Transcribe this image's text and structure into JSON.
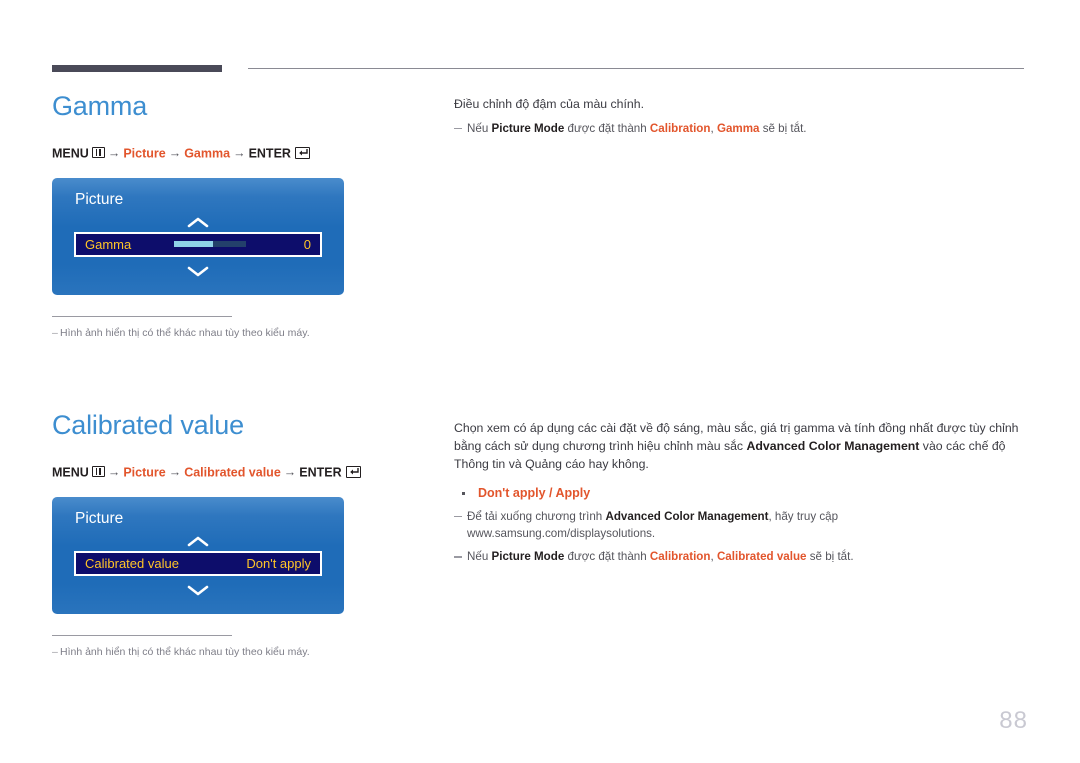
{
  "page": {
    "number": "88"
  },
  "sections": [
    {
      "title": "Gamma",
      "menu_path": {
        "menu_label": "MENU",
        "menu_icon": "menu-grid-icon",
        "arrow": "→",
        "step1": "Picture",
        "step2": "Gamma",
        "enter_label": "ENTER",
        "enter_icon": "enter-return-icon"
      },
      "osd": {
        "title": "Picture",
        "up_icon": "chevron-up-icon",
        "down_icon": "chevron-down-icon",
        "row_label": "Gamma",
        "row_value": "0",
        "slider_percent": 55,
        "has_slider": true
      },
      "footnote": "Hình ảnh hiển thị có thể khác nhau tùy theo kiểu máy.",
      "right": {
        "intro": "Điều chỉnh độ đậm của màu chính.",
        "notes": [
          {
            "parts": [
              {
                "t": "Nếu ",
                "s": "plain"
              },
              {
                "t": "Picture Mode",
                "s": "bold"
              },
              {
                "t": " được đặt thành ",
                "s": "plain"
              },
              {
                "t": "Calibration",
                "s": "orange"
              },
              {
                "t": ", ",
                "s": "plain"
              },
              {
                "t": "Gamma",
                "s": "orange"
              },
              {
                "t": " sẽ bị tắt.",
                "s": "plain"
              }
            ]
          }
        ]
      }
    },
    {
      "title": "Calibrated value",
      "menu_path": {
        "menu_label": "MENU",
        "menu_icon": "menu-grid-icon",
        "arrow": "→",
        "step1": "Picture",
        "step2": "Calibrated value",
        "enter_label": "ENTER",
        "enter_icon": "enter-return-icon"
      },
      "osd": {
        "title": "Picture",
        "up_icon": "chevron-up-icon",
        "down_icon": "chevron-down-icon",
        "row_label": "Calibrated value",
        "row_value": "Don't apply",
        "has_slider": false
      },
      "footnote": "Hình ảnh hiển thị có thể khác nhau tùy theo kiểu máy.",
      "right": {
        "paragraph_parts": [
          {
            "t": "Chọn xem có áp dụng các cài đặt về độ sáng, màu sắc, giá trị gamma và tính đồng nhất được tùy chỉnh bằng cách sử dụng chương trình hiệu chỉnh màu sắc ",
            "s": "plain"
          },
          {
            "t": "Advanced Color Management",
            "s": "bold"
          },
          {
            "t": " vào các chế độ Thông tin và Quảng cáo hay không.",
            "s": "plain"
          }
        ],
        "options": "Don't apply / Apply",
        "notes": [
          {
            "parts": [
              {
                "t": "Để tải xuống chương trình ",
                "s": "plain"
              },
              {
                "t": "Advanced Color Management",
                "s": "bold"
              },
              {
                "t": ", hãy truy cập www.samsung.com/displaysolutions.",
                "s": "plain"
              }
            ]
          },
          {
            "parts": [
              {
                "t": "Nếu ",
                "s": "plain"
              },
              {
                "t": "Picture Mode",
                "s": "bold"
              },
              {
                "t": " được đặt thành ",
                "s": "plain"
              },
              {
                "t": "Calibration",
                "s": "orange"
              },
              {
                "t": ", ",
                "s": "plain"
              },
              {
                "t": "Calibrated value",
                "s": "orange"
              },
              {
                "t": " sẽ bị tắt.",
                "s": "plain"
              }
            ]
          }
        ]
      }
    }
  ],
  "colors": {
    "heading": "#3d8ed0",
    "accent_orange": "#e2552c",
    "osd_blue": "#1f6cb8",
    "osd_row_bg": "#0d0d6b",
    "osd_row_text": "#ffc528",
    "header_bar": "#4a4a58"
  }
}
